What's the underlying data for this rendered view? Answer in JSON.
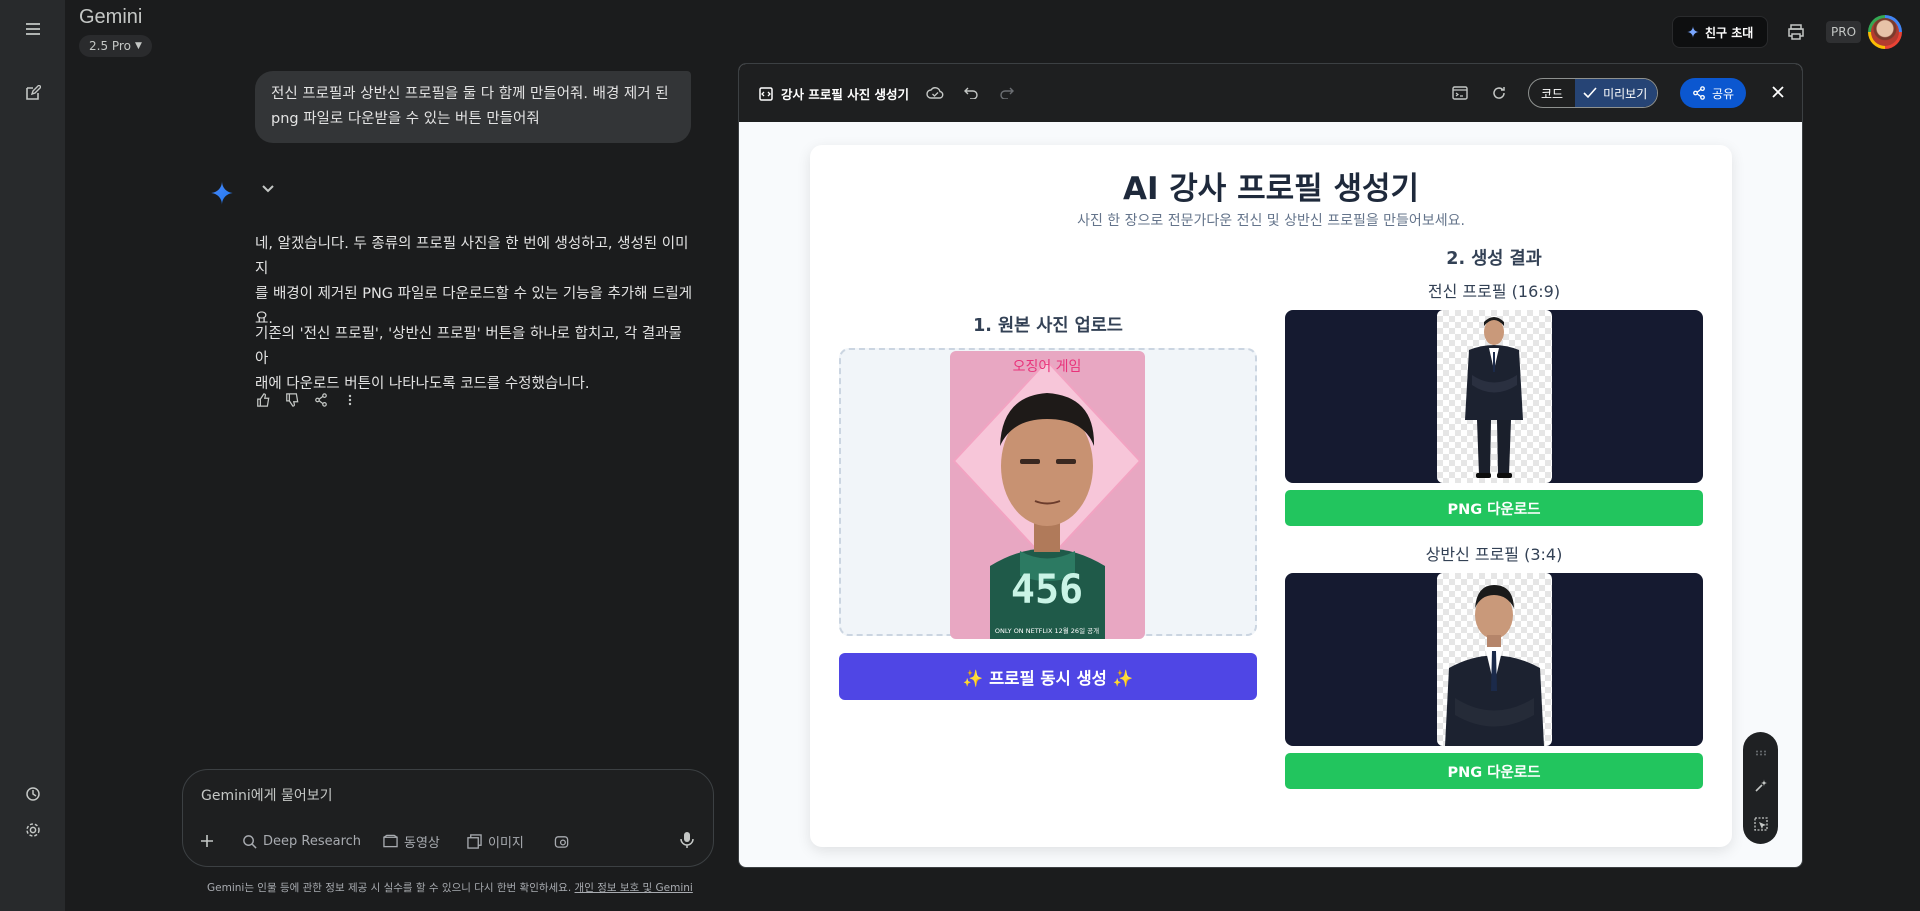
{
  "header": {
    "brand": "Gemini",
    "model": "2.5 Pro",
    "invite_label": "친구 초대",
    "pro_badge": "PRO"
  },
  "chat": {
    "user_message_line1": "전신 프로필과 상반신 프로필을 둘 다 함께 만들어줘. 배경 제거 된",
    "user_message_line2": "png 파일로 다운받을 수 있는 버튼 만들어줘",
    "response_p1_line1": "네, 알겠습니다. 두 종류의 프로필 사진을 한 번에 생성하고, 생성된 이미지",
    "response_p1_line2": "를 배경이 제거된 PNG 파일로 다운로드할 수 있는 기능을 추가해 드릴게",
    "response_p1_line3": "요.",
    "response_p2_line1": "기존의 '전신 프로필', '상반신 프로필' 버튼을 하나로 합치고, 각 결과물 아",
    "response_p2_line2": "래에 다운로드 버튼이 나타나도록 코드를 수정했습니다."
  },
  "input": {
    "placeholder": "Gemini에게 물어보기",
    "tools": [
      "Deep Research",
      "동영상",
      "이미지"
    ]
  },
  "disclaimer": {
    "text": "Gemini는 인물 등에 관한 정보 제공 시 실수를 할 수 있으니 다시 한번 확인하세요. ",
    "link": "개인 정보 보호 및 Gemini"
  },
  "canvas": {
    "title": "강사 프로필 사진 생성기",
    "code_label": "코드",
    "preview_label": "미리보기",
    "share_label": "공유"
  },
  "app": {
    "title": "AI 강사 프로필 생성기",
    "subtitle": "사진 한 장으로 전문가다운 전신 및 상반신 프로필을 만들어보세요.",
    "section1_title": "1. 원본 사진 업로드",
    "poster_top_text": "오징어 게임",
    "poster_number": "456",
    "poster_footer": "ONLY ON NETFLIX 12월 26일 공개",
    "generate_button": "✨ 프로필 동시 생성 ✨",
    "section2_title": "2. 생성 결과",
    "full_label": "전신 프로필 (16:9)",
    "half_label": "상반신 프로필 (3:4)",
    "download_label": "PNG 다운로드"
  },
  "colors": {
    "accent_indigo": "#4f46e5",
    "download_green": "#22c55e",
    "share_blue": "#0b57d0",
    "result_bg": "#151a30"
  }
}
